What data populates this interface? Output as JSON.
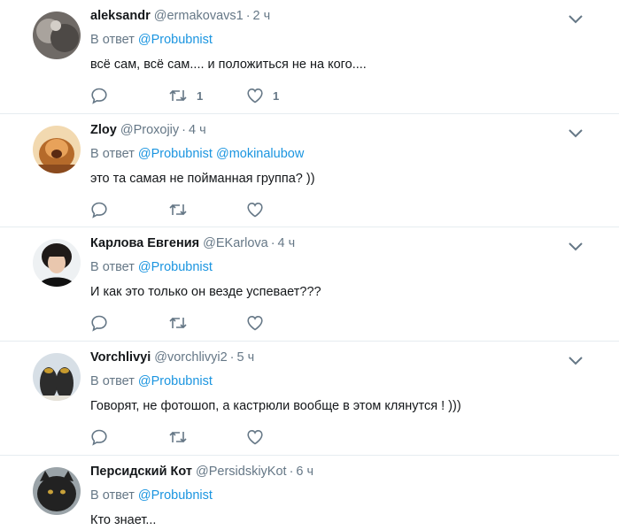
{
  "reply_prefix": "В ответ",
  "colors": {
    "link": "#1b95e0",
    "secondary": "#657786",
    "divider": "#e6ecf0"
  },
  "icons": {
    "reply": "reply-bubble-icon",
    "retweet": "retweet-icon",
    "like": "heart-icon",
    "menu": "chevron-down-icon"
  },
  "tweets": [
    {
      "name": "aleksandr",
      "handle": "@ermakovavs1",
      "time": "2 ч",
      "reply_to": [
        "@Probubnist"
      ],
      "text": "всё сам, всё сам.... и положиться не на кого....",
      "retweets": "1",
      "likes": "1"
    },
    {
      "name": "Zloy",
      "handle": "@Proxojiy",
      "time": "4 ч",
      "reply_to": [
        "@Probubnist",
        "@mokinalubow"
      ],
      "text": "это та самая не пойманная группа? ))",
      "retweets": "",
      "likes": ""
    },
    {
      "name": "Карлова Евгения",
      "handle": "@EKarlova",
      "time": "4 ч",
      "reply_to": [
        "@Probubnist"
      ],
      "text": "И как это только он везде успевает???",
      "retweets": "",
      "likes": ""
    },
    {
      "name": "Vorchlivyi",
      "handle": "@vorchlivyi2",
      "time": "5 ч",
      "reply_to": [
        "@Probubnist"
      ],
      "text": "Говорят, не фотошоп, а кастрюли вообще в этом клянутся ! )))",
      "retweets": "",
      "likes": ""
    },
    {
      "name": "Персидский Кот",
      "handle": "@PersidskiyKot",
      "time": "6 ч",
      "reply_to": [
        "@Probubnist"
      ],
      "text": "Кто знает...",
      "retweets": "",
      "likes": ""
    }
  ]
}
